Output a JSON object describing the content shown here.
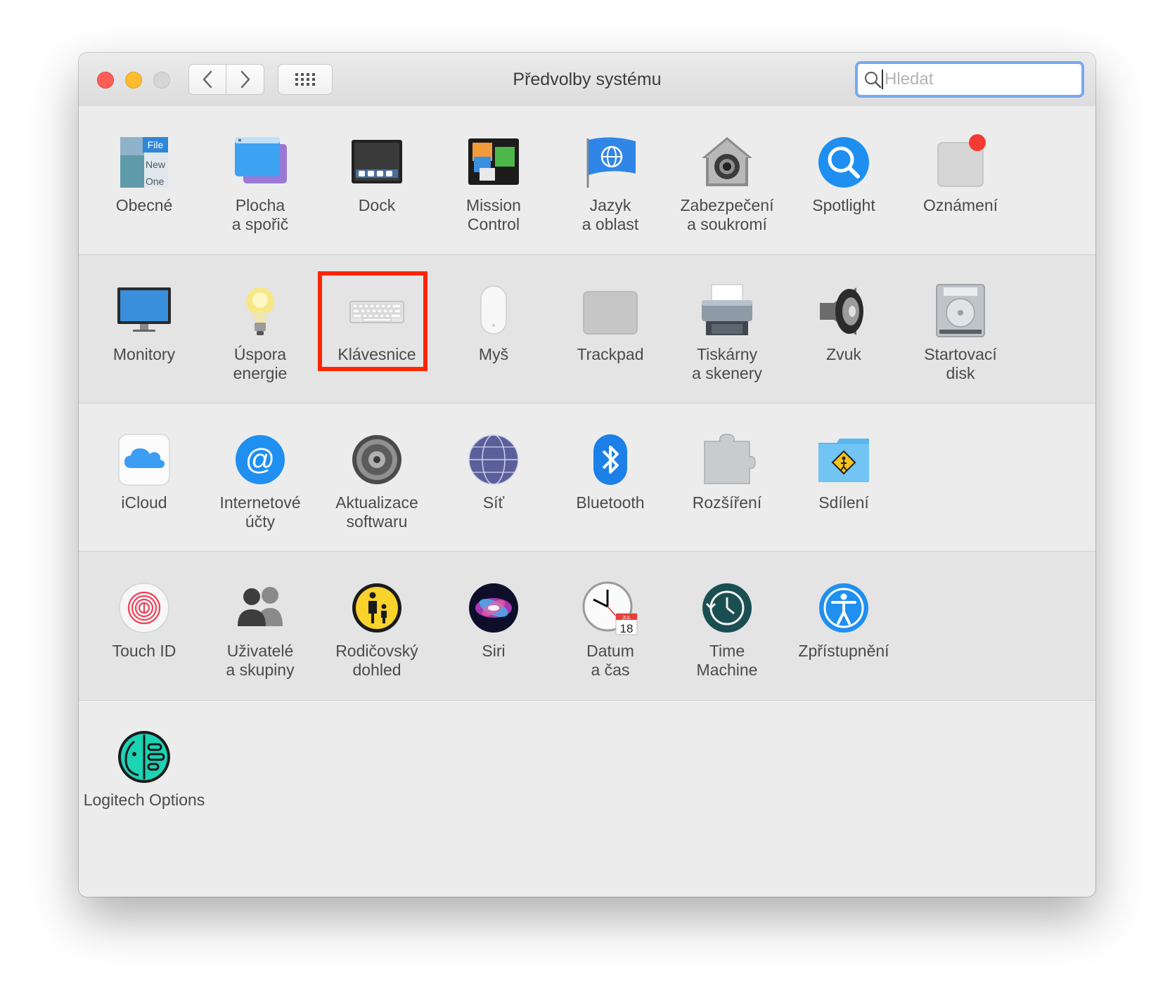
{
  "window": {
    "title": "Předvolby systému"
  },
  "search": {
    "placeholder": "Hledat"
  },
  "icons": {
    "back": "chevron-left",
    "forward": "chevron-right",
    "grid": "grid-dots",
    "search": "magnifier"
  },
  "colors": {
    "highlight": "#ff2600",
    "close": "#fd5f57",
    "minimize": "#febc2e",
    "searchFocus": "#77a9f0"
  },
  "rows": [
    {
      "items": [
        {
          "id": "obecne",
          "label": "Obecné",
          "icon_text": [
            "File",
            "New",
            "One"
          ]
        },
        {
          "id": "plocha",
          "label": "Plocha\na spořič"
        },
        {
          "id": "dock",
          "label": "Dock"
        },
        {
          "id": "mission",
          "label": "Mission\nControl"
        },
        {
          "id": "jazyk",
          "label": "Jazyk\na oblast"
        },
        {
          "id": "zabezpeceni",
          "label": "Zabezpečení\na soukromí"
        },
        {
          "id": "spotlight",
          "label": "Spotlight"
        },
        {
          "id": "oznameni",
          "label": "Oznámení"
        }
      ]
    },
    {
      "items": [
        {
          "id": "monitory",
          "label": "Monitory"
        },
        {
          "id": "uspora",
          "label": "Úspora\nenergie"
        },
        {
          "id": "klavesnice",
          "label": "Klávesnice",
          "highlighted": true
        },
        {
          "id": "mys",
          "label": "Myš"
        },
        {
          "id": "trackpad",
          "label": "Trackpad"
        },
        {
          "id": "tiskarny",
          "label": "Tiskárny\na skenery"
        },
        {
          "id": "zvuk",
          "label": "Zvuk"
        },
        {
          "id": "startovaci",
          "label": "Startovací\ndisk"
        }
      ]
    },
    {
      "items": [
        {
          "id": "icloud",
          "label": "iCloud"
        },
        {
          "id": "internetove",
          "label": "Internetové\núčty"
        },
        {
          "id": "aktualizace",
          "label": "Aktualizace\nsoftwaru"
        },
        {
          "id": "sit",
          "label": "Síť"
        },
        {
          "id": "bluetooth",
          "label": "Bluetooth"
        },
        {
          "id": "rozsireni",
          "label": "Rozšíření"
        },
        {
          "id": "sdileni",
          "label": "Sdílení"
        }
      ]
    },
    {
      "items": [
        {
          "id": "touchid",
          "label": "Touch ID"
        },
        {
          "id": "uzivatele",
          "label": "Uživatelé\na skupiny"
        },
        {
          "id": "rodicovsky",
          "label": "Rodičovský\ndohled"
        },
        {
          "id": "siri",
          "label": "Siri"
        },
        {
          "id": "datum",
          "label": "Datum\na čas",
          "icon_text": [
            "JUL",
            "18"
          ]
        },
        {
          "id": "timemachine",
          "label": "Time\nMachine"
        },
        {
          "id": "zpristupneni",
          "label": "Zpřístupnění"
        }
      ]
    },
    {
      "items": [
        {
          "id": "logitech",
          "label": "Logitech Options"
        }
      ]
    }
  ]
}
